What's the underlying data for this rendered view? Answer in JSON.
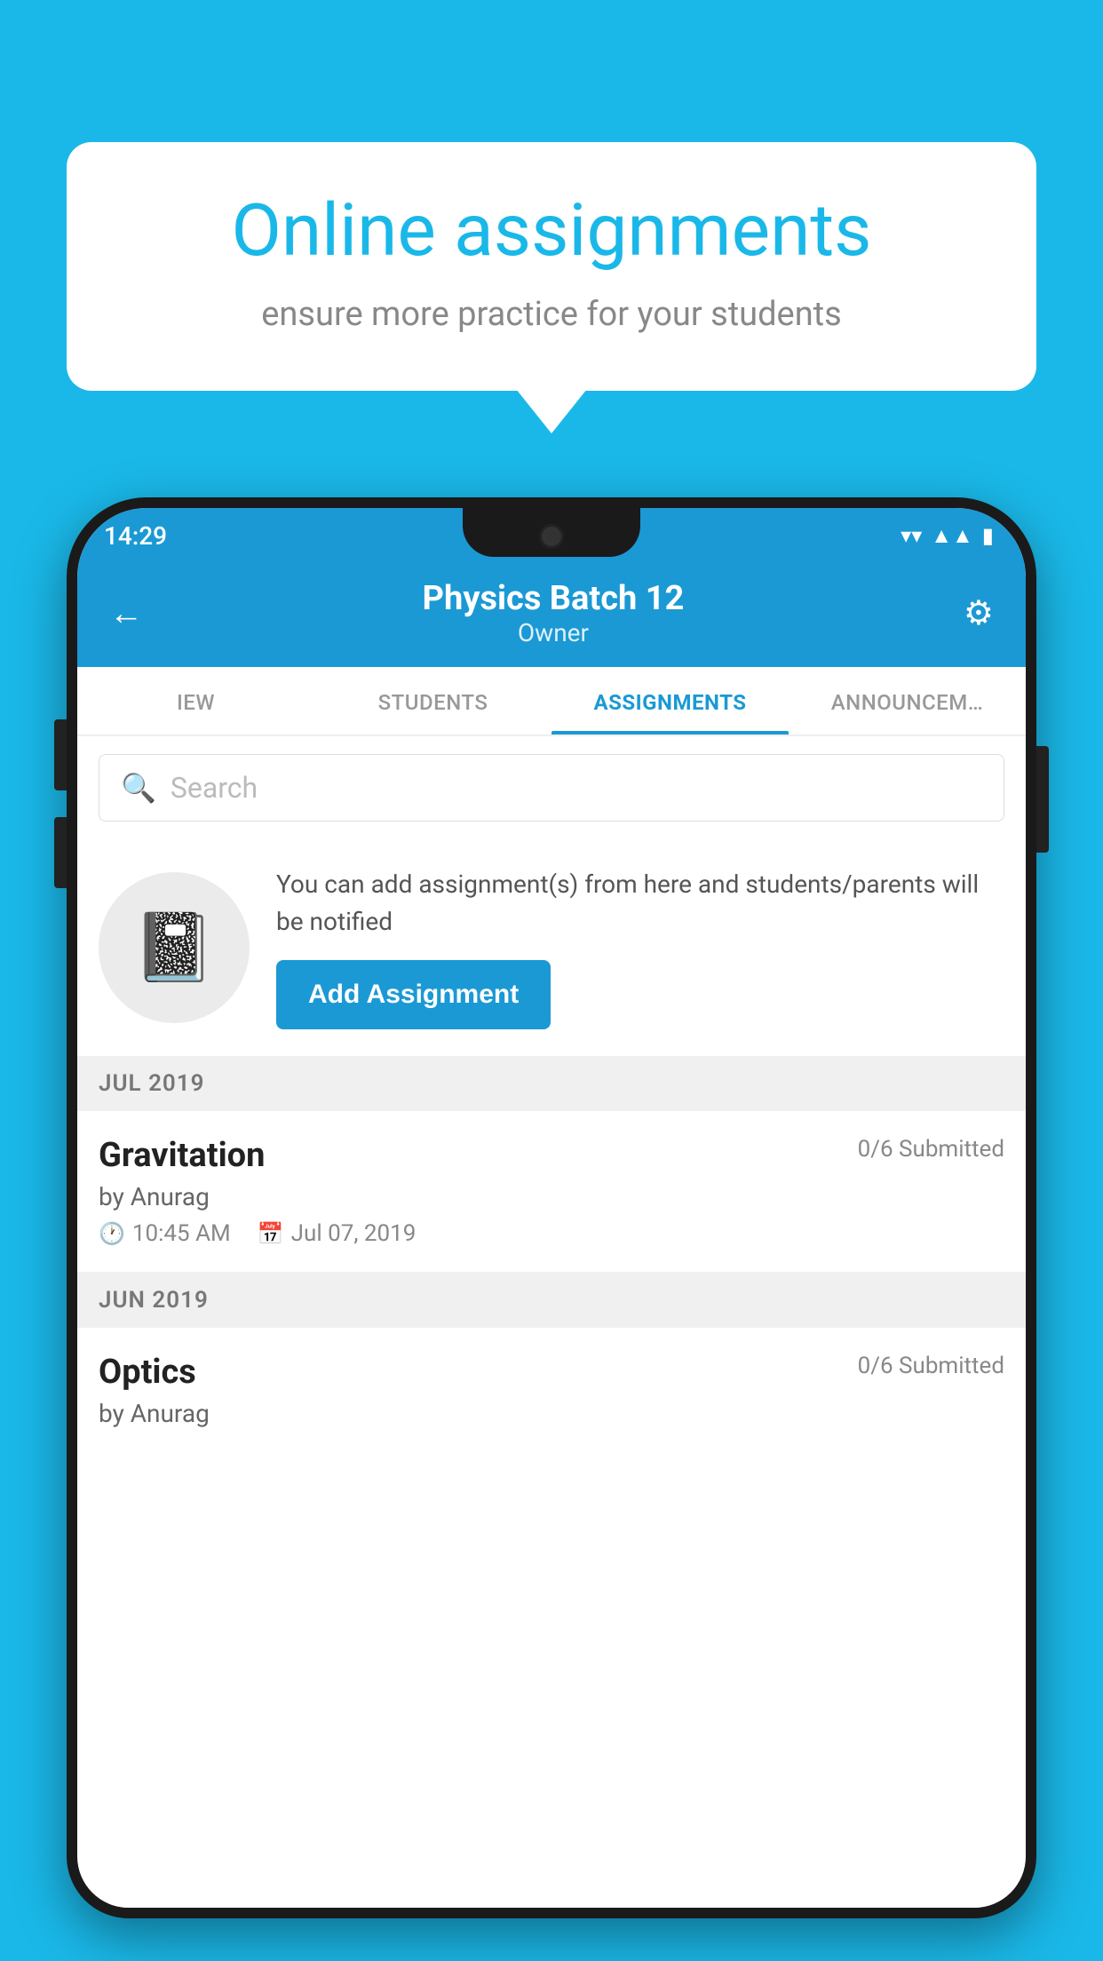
{
  "background": {
    "color": "#1ab8e8"
  },
  "speech_bubble": {
    "title": "Online assignments",
    "subtitle": "ensure more practice for your students"
  },
  "status_bar": {
    "time": "14:29",
    "icons": [
      "wifi",
      "signal",
      "battery"
    ]
  },
  "header": {
    "title": "Physics Batch 12",
    "subtitle": "Owner",
    "back_label": "←",
    "settings_label": "⚙"
  },
  "tabs": [
    {
      "id": "iew",
      "label": "IEW",
      "active": false
    },
    {
      "id": "students",
      "label": "STUDENTS",
      "active": false
    },
    {
      "id": "assignments",
      "label": "ASSIGNMENTS",
      "active": true
    },
    {
      "id": "announcements",
      "label": "ANNOUNCEM…",
      "active": false
    }
  ],
  "search": {
    "placeholder": "Search"
  },
  "info_card": {
    "description": "You can add assignment(s) from here and students/parents will be notified",
    "button_label": "Add Assignment"
  },
  "sections": [
    {
      "month_label": "JUL 2019",
      "assignments": [
        {
          "name": "Gravitation",
          "submitted": "0/6 Submitted",
          "author": "by Anurag",
          "time": "10:45 AM",
          "date": "Jul 07, 2019"
        }
      ]
    },
    {
      "month_label": "JUN 2019",
      "assignments": [
        {
          "name": "Optics",
          "submitted": "0/6 Submitted",
          "author": "by Anurag",
          "time": "",
          "date": ""
        }
      ]
    }
  ]
}
